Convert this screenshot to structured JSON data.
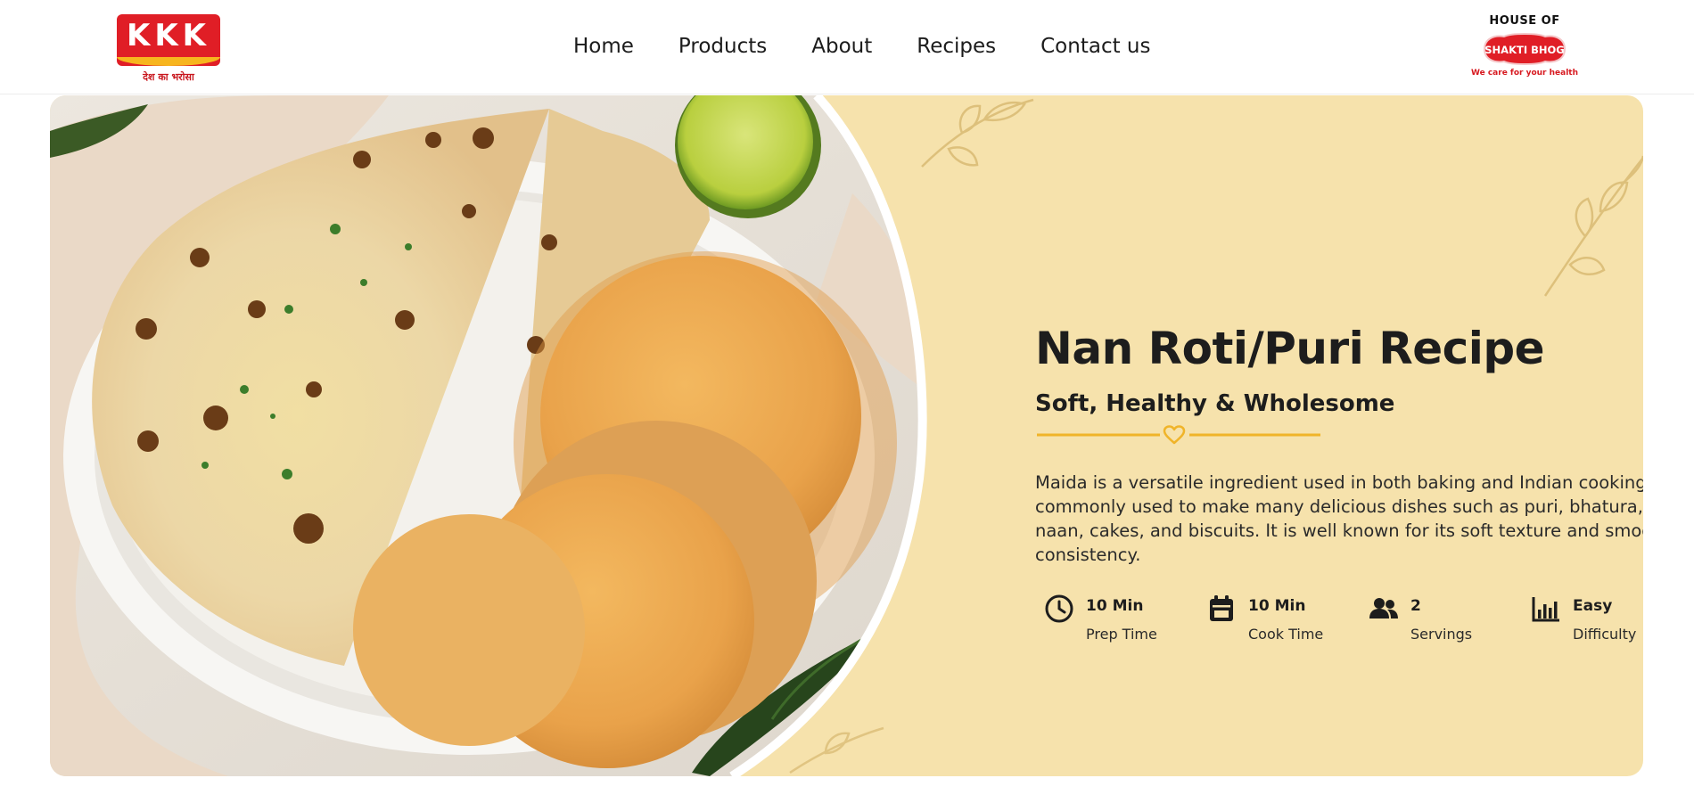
{
  "header": {
    "brand_left": {
      "name": "KKK",
      "tagline": "देश का भरोसा"
    },
    "nav": [
      {
        "label": "Home"
      },
      {
        "label": "Products"
      },
      {
        "label": "About"
      },
      {
        "label": "Recipes"
      },
      {
        "label": "Contact us"
      }
    ],
    "brand_right": {
      "top": "HOUSE OF",
      "name": "SHAKTI BHOG",
      "tagline": "We care for your health"
    }
  },
  "hero": {
    "title": "Nan Roti/Puri Recipe",
    "subtitle": "Soft, Healthy & Wholesome",
    "description": "Maida is a versatile ingredient used in both baking and Indian cooking. It is commonly used to make many delicious dishes such as puri, bhatura, naan, cakes, and biscuits. It is well known for its soft texture and smooth consistency.",
    "stats": [
      {
        "icon": "clock-icon",
        "value": "10 Min",
        "label": "Prep Time"
      },
      {
        "icon": "calendar-icon",
        "value": "10 Min",
        "label": "Cook Time"
      },
      {
        "icon": "people-icon",
        "value": "2",
        "label": "Servings"
      },
      {
        "icon": "bar-chart-icon",
        "value": "Easy",
        "label": "Difficulty"
      }
    ]
  },
  "colors": {
    "brand_red": "#e01e26",
    "brand_yellow": "#f7b51e",
    "hero_background": "#f6e2ac",
    "divider_gold": "#f0b429",
    "text_dark": "#1d1d1d"
  }
}
